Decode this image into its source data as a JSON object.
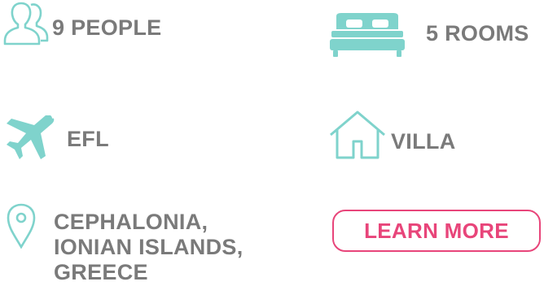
{
  "colors": {
    "accent_teal": "#7fd3cc",
    "text_gray": "#7a7a7a",
    "cta_pink": "#e8457a"
  },
  "features": {
    "people": {
      "icon": "people-icon",
      "label": "9 PEOPLE"
    },
    "rooms": {
      "icon": "bed-icon",
      "label": "5 ROOMS"
    },
    "airport": {
      "icon": "airplane-icon",
      "label": "EFL"
    },
    "type": {
      "icon": "house-icon",
      "label": "VILLA"
    },
    "location": {
      "icon": "map-pin-icon",
      "label": "CEPHALONIA, IONIAN ISLANDS, GREECE"
    }
  },
  "cta": {
    "label": "LEARN MORE"
  }
}
